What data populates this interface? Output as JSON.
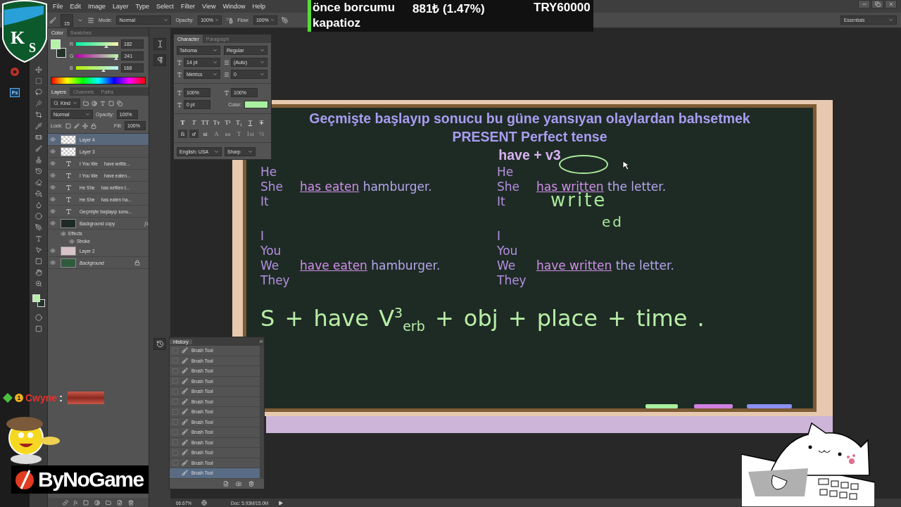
{
  "logo": {
    "letters": [
      "K",
      "S"
    ]
  },
  "menu": [
    "File",
    "Edit",
    "Image",
    "Layer",
    "Type",
    "Select",
    "Filter",
    "View",
    "Window",
    "Help"
  ],
  "options_bar": {
    "brush_size": "15",
    "mode_label": "Mode:",
    "mode": "Normal",
    "opacity_label": "Opacity:",
    "opacity": "100%",
    "flow_label": "Flow:",
    "flow": "100%"
  },
  "ticker": {
    "message": [
      "önce borcumu",
      "kapatioz"
    ],
    "amount": "881₺ (1.47%)",
    "goal": "TRY60000"
  },
  "workspace": "Essentials",
  "dock_apps": [
    {
      "label": "Ps"
    }
  ],
  "color_panel": {
    "tabs": [
      {
        "label": "Color",
        "selected": true
      },
      {
        "label": "Swatches",
        "selected": false
      }
    ],
    "channels": [
      {
        "name": "R",
        "value": "182",
        "level": 0.71
      },
      {
        "name": "G",
        "value": "241",
        "level": 0.95
      },
      {
        "name": "B",
        "value": "168",
        "level": 0.66
      }
    ]
  },
  "layers_panel": {
    "tabs": [
      {
        "label": "Layers",
        "selected": true
      },
      {
        "label": "Channels",
        "selected": false
      },
      {
        "label": "Paths",
        "selected": false
      }
    ],
    "filter": "Kind",
    "blend_mode": "Normal",
    "opacity_label": "Opacity:",
    "opacity": "100%",
    "lock_label": "Lock:",
    "fill_label": "Fill:",
    "fill": "100%",
    "layers": [
      {
        "kind": "transparent",
        "labels": [
          "Layer 4"
        ],
        "selected": true,
        "visible": true,
        "locked": false
      },
      {
        "kind": "transparent",
        "labels": [
          "Layer 3"
        ],
        "selected": false,
        "visible": true,
        "locked": false
      },
      {
        "kind": "text",
        "labels": [
          "I You We",
          "have writte..."
        ],
        "selected": false,
        "visible": true,
        "locked": false
      },
      {
        "kind": "text",
        "labels": [
          "I You We",
          "have eaten..."
        ],
        "selected": false,
        "visible": true,
        "locked": false
      },
      {
        "kind": "text",
        "labels": [
          "He She",
          "has written t..."
        ],
        "selected": false,
        "visible": true,
        "locked": false
      },
      {
        "kind": "text",
        "labels": [
          "He She",
          "has eaten ha..."
        ],
        "selected": false,
        "visible": true,
        "locked": false
      },
      {
        "kind": "text",
        "labels": [
          "Geçmişte başlayıp sonu..."
        ],
        "selected": false,
        "visible": true,
        "locked": false
      },
      {
        "kind": "fill",
        "color": "#1e2b25",
        "labels": [
          "Background copy"
        ],
        "badge": "fx",
        "selected": false,
        "visible": true,
        "locked": false,
        "children": [
          {
            "label": "Effects",
            "visible": true,
            "children": [
              {
                "label": "Stroke",
                "visible": true
              }
            ]
          }
        ]
      },
      {
        "kind": "fill",
        "color": "#d6c4c8",
        "labels": [
          "Layer 2"
        ],
        "selected": false,
        "visible": true,
        "locked": false
      },
      {
        "kind": "fill",
        "color": "#2f5a3e",
        "labels": [
          "Background"
        ],
        "selected": false,
        "visible": true,
        "locked": true
      }
    ],
    "footer_effects": "fx"
  },
  "character_panel": {
    "tabs": [
      {
        "label": "Character",
        "selected": true
      },
      {
        "label": "Paragraph",
        "selected": false
      }
    ],
    "font_family": "Tahoma",
    "font_style": "Regular",
    "size": "14 pt",
    "leading": "(Auto)",
    "kerning": "Metrics",
    "tracking": "0",
    "vertical_scale": "100%",
    "horizontal_scale": "100%",
    "baseline_shift": "0 pt",
    "color_label": "Color:",
    "style_buttons": [
      {
        "kind": "bold",
        "label": "T"
      },
      {
        "kind": "italic",
        "label": "T"
      },
      {
        "kind": "caps",
        "label": "TT"
      },
      {
        "kind": "smallcaps",
        "label": "Tт"
      },
      {
        "kind": "super",
        "label": "T¹"
      },
      {
        "kind": "sub",
        "label": "T₁"
      },
      {
        "kind": "underline",
        "label": "T"
      },
      {
        "kind": "strike",
        "label": "T"
      }
    ],
    "opentype_buttons": [
      {
        "label": "fi",
        "selected": true,
        "disabled": false
      },
      {
        "label": "ơ",
        "selected": true,
        "disabled": false
      },
      {
        "label": "st",
        "selected": false,
        "disabled": false
      },
      {
        "label": "A",
        "selected": false,
        "disabled": true
      },
      {
        "label": "aa",
        "selected": false,
        "disabled": true
      },
      {
        "label": "T",
        "selected": false,
        "disabled": true
      },
      {
        "label": "1st",
        "selected": false,
        "disabled": true
      },
      {
        "label": "½",
        "selected": false,
        "disabled": true
      }
    ],
    "language": "English: USA",
    "antialias": "Sharp"
  },
  "board": {
    "title_lines": [
      "Geçmişte başlayıp sonucu bu güne yansıyan olaylardan bahsetmek",
      "PRESENT Perfect tense",
      "have + v3"
    ],
    "columns": [
      {
        "groups": [
          {
            "lines": [
              {
                "word": "He"
              },
              {
                "word": "She",
                "verb": "has eaten",
                "object": "hamburger."
              },
              {
                "word": "It"
              }
            ]
          },
          {
            "lines": [
              {
                "word": "I"
              },
              {
                "word": "You"
              },
              {
                "word": "We",
                "verb": "have eaten",
                "object": "hamburger."
              },
              {
                "word": "They"
              }
            ]
          }
        ]
      },
      {
        "groups": [
          {
            "lines": [
              {
                "word": "He"
              },
              {
                "word": "She",
                "verb": "has written",
                "object": "the letter."
              },
              {
                "word": "It"
              }
            ]
          },
          {
            "lines": [
              {
                "word": "I"
              },
              {
                "word": "You"
              },
              {
                "word": "We",
                "verb": "have written",
                "object": "the letter."
              },
              {
                "word": "They"
              }
            ]
          }
        ]
      }
    ],
    "handwriting": [
      "write",
      "ed"
    ],
    "formula": "S + have V$^{3}$$_{erb}$ + obj + place + time ."
  },
  "history_panel": {
    "title": "History",
    "steps": [
      {
        "label": "Brush Tool",
        "selected": false
      },
      {
        "label": "Brush Tool",
        "selected": false
      },
      {
        "label": "Brush Tool",
        "selected": false
      },
      {
        "label": "Brush Tool",
        "selected": false
      },
      {
        "label": "Brush Tool",
        "selected": false
      },
      {
        "label": "Brush Tool",
        "selected": false
      },
      {
        "label": "Brush Tool",
        "selected": false
      },
      {
        "label": "Brush Tool",
        "selected": false
      },
      {
        "label": "Brush Tool",
        "selected": false
      },
      {
        "label": "Brush Tool",
        "selected": false
      },
      {
        "label": "Brush Tool",
        "selected": false
      },
      {
        "label": "Brush Tool",
        "selected": false
      },
      {
        "label": "Brush Tool",
        "selected": true
      }
    ]
  },
  "status_bar": {
    "zoom": "66.67%",
    "doc": "Doc: 5.93M/15.0M"
  },
  "chat": {
    "badge": "1",
    "user": "Cwyne",
    "separator": ":"
  },
  "banner": {
    "text": "ByNoGame"
  }
}
